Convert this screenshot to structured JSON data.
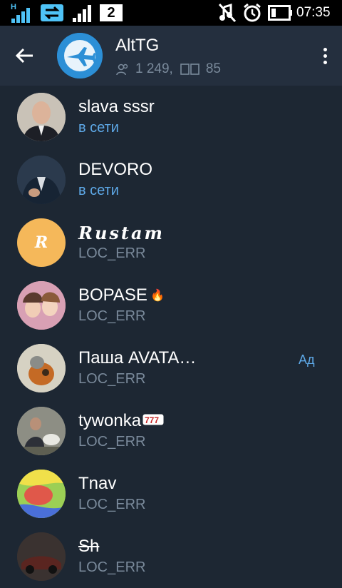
{
  "status_bar": {
    "network_type": "H",
    "sim_slot": "2",
    "time": "07:35",
    "icons": [
      "signal-bars-icon",
      "data-transfer-icon",
      "sim-2-signal-icon",
      "music-muted-icon",
      "alarm-icon",
      "battery-icon"
    ]
  },
  "header": {
    "title": "AltTG",
    "members_count": "1 249,",
    "online_count": "85",
    "icons": [
      "back-arrow-icon",
      "jet-avatar-icon",
      "members-icon",
      "online-icon",
      "more-vert-icon"
    ]
  },
  "members": [
    {
      "name": "slava sssr",
      "status": "в сети",
      "online": true,
      "avatar_color": "#b7b1a9"
    },
    {
      "name": "DEVORO",
      "status": "в сети",
      "online": true,
      "avatar_color": "#24354a"
    },
    {
      "name": "Rustam",
      "status": "LOC_ERR",
      "online": false,
      "avatar_color": "#f5b85a",
      "avatar_letter": "R"
    },
    {
      "name": "BOPASE",
      "status": "LOC_ERR",
      "online": false,
      "avatar_color": "#c88a9a",
      "emoji_icon": "fire-icon"
    },
    {
      "name": "Паша AVATA…",
      "status": "LOC_ERR",
      "online": false,
      "avatar_color": "#b3ad98",
      "badge": "Ад"
    },
    {
      "name": "tywonka",
      "status": "LOC_ERR",
      "online": false,
      "avatar_color": "#7b7c72",
      "emoji_icon": "slot-machine-777-icon"
    },
    {
      "name": "Tnav",
      "status": "LOC_ERR",
      "online": false,
      "avatar_color": "#93c84a"
    },
    {
      "name": "Sh",
      "status": "LOC_ERR",
      "online": false,
      "avatar_color": "#3a3230"
    }
  ],
  "colors": {
    "background": "#1d2733",
    "app_bar": "#242f3e",
    "online_text": "#5ea9e8",
    "secondary_text": "#7a8a9b",
    "status_bar": "#000000"
  }
}
